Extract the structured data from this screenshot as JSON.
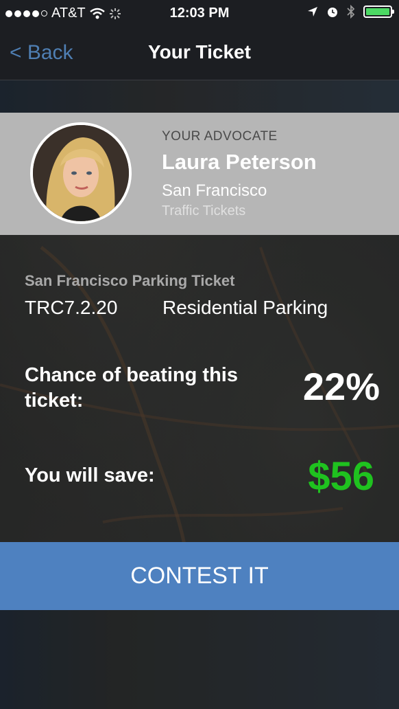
{
  "status_bar": {
    "carrier": "AT&T",
    "time": "12:03 PM",
    "signal_icon": "signal-dots-icon",
    "wifi_icon": "wifi-icon",
    "activity_icon": "spinner-icon",
    "location_icon": "location-arrow-icon",
    "alarm_icon": "alarm-icon",
    "bluetooth_icon": "bluetooth-icon",
    "battery_icon": "battery-charging-icon"
  },
  "nav": {
    "back_label": "< Back",
    "title": "Your Ticket"
  },
  "advocate": {
    "label": "YOUR ADVOCATE",
    "name": "Laura Peterson",
    "city": "San Francisco",
    "specialty": "Traffic Tickets"
  },
  "ticket": {
    "type": "San Francisco Parking Ticket",
    "code": "TRC7.2.20",
    "description": "Residential Parking"
  },
  "chance": {
    "label": "Chance of beating this ticket:",
    "value": "22%"
  },
  "savings": {
    "label": "You will save:",
    "value": "$56"
  },
  "action": {
    "contest_label": "CONTEST IT"
  },
  "colors": {
    "accent": "#4e81c0",
    "savings": "#1fc21f",
    "back_link": "#4f7fb3",
    "card_bg": "#b6b6b6"
  }
}
